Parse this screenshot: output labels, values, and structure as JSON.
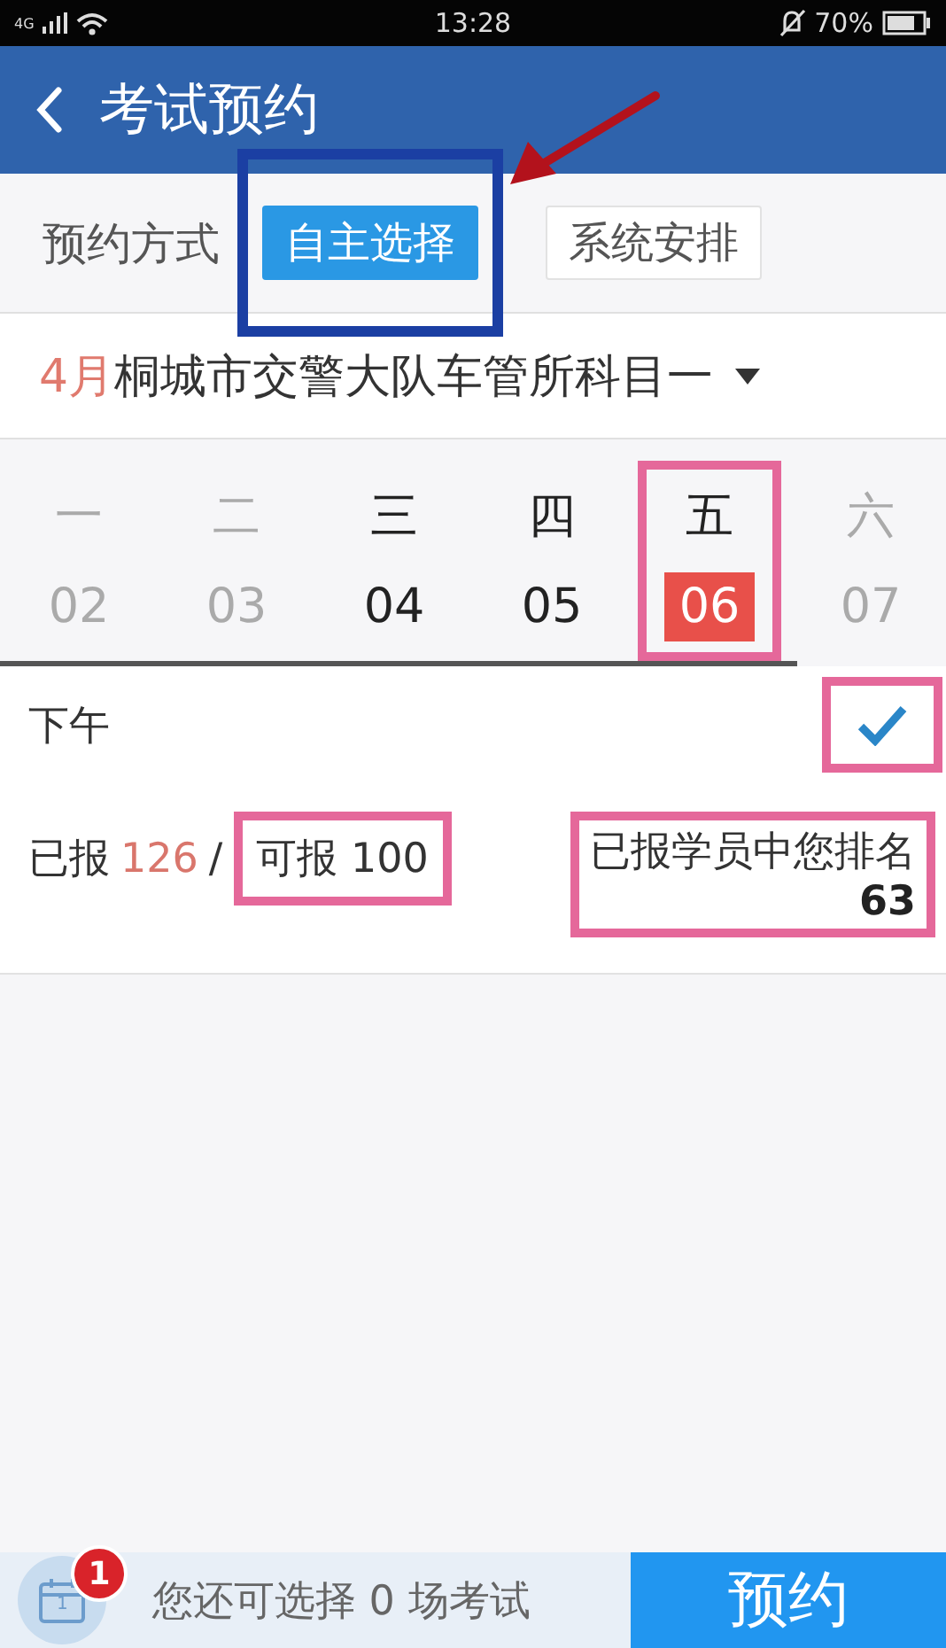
{
  "status_bar": {
    "network": "4G",
    "time": "13:28",
    "battery": "70%"
  },
  "header": {
    "title": "考试预约"
  },
  "mode": {
    "label": "预约方式",
    "arrow": true,
    "options": [
      {
        "label": "自主选择",
        "selected": true,
        "highlighted": true
      },
      {
        "label": "系统安排",
        "selected": false
      }
    ]
  },
  "location": {
    "month": "4月",
    "name": "桐城市交警大队车管所科目一"
  },
  "days": [
    {
      "weekday": "一",
      "date": "02",
      "available": false,
      "selected": false
    },
    {
      "weekday": "二",
      "date": "03",
      "available": false,
      "selected": false
    },
    {
      "weekday": "三",
      "date": "04",
      "available": true,
      "selected": false
    },
    {
      "weekday": "四",
      "date": "05",
      "available": true,
      "selected": false
    },
    {
      "weekday": "五",
      "date": "06",
      "available": true,
      "selected": true,
      "highlighted": true
    },
    {
      "weekday": "六",
      "date": "07",
      "available": false,
      "selected": false
    }
  ],
  "session": {
    "label": "下午",
    "checked": true,
    "highlighted": true
  },
  "quota": {
    "booked_label": "已报",
    "booked": "126",
    "separator": "/",
    "capacity": "可报 100",
    "capacity_highlighted": true
  },
  "rank": {
    "label": "已报学员中您排名",
    "value": "63",
    "highlighted": true
  },
  "footer": {
    "calendar_day": "1",
    "badge": "1",
    "message": "您还可选择 0 场考试",
    "button": "预约"
  }
}
